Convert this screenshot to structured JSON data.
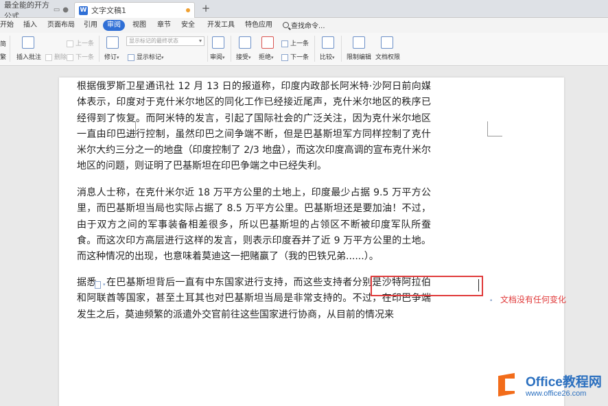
{
  "tabs": [
    {
      "label": "最全能的开方公式",
      "active": false
    },
    {
      "label": "文字文稿1",
      "active": true,
      "modified": true
    }
  ],
  "menu": {
    "items": [
      "开始",
      "插入",
      "页面布局",
      "引用",
      "审阅",
      "视图",
      "章节",
      "安全",
      "开发工具",
      "特色应用"
    ],
    "active": "审阅",
    "search_label": "查找命令..."
  },
  "toolbar": {
    "left_partial_1": "简",
    "left_partial_2": "繁",
    "insert_comment": "插入批注",
    "delete": "删除",
    "prev_comment": "上一条",
    "next_comment": "下一条",
    "track_changes": "修订",
    "display_combo": "显示标记的最终状态",
    "show_markup": "显示标记",
    "review": "审阅",
    "accept": "接受",
    "reject": "拒绝",
    "prev_change": "上一条",
    "next_change": "下一条",
    "compare": "比较",
    "restrict_edit": "限制编辑",
    "doc_permission": "文档权限"
  },
  "document": {
    "paragraphs": [
      "根据俄罗斯卫星通讯社 12 月 13 日的报道称，印度内政部长阿米特·沙阿日前向媒体表示，印度对于克什米尔地区的同化工作已经接近尾声，克什米尔地区的秩序已经得到了恢复。而阿米特的发言，引起了国际社会的广泛关注，因为克什米尔地区一直由印巴进行控制，虽然印巴之间争端不断，但是巴基斯坦军方同样控制了克什米尔大约三分之一的地盘（印度控制了 2/3 地盘），而这次印度高调的宣布克什米尔地区的问题，则证明了巴基斯坦在印巴争端之中已经失利。",
      "消息人士称，在克什米尔近 18 万平方公里的土地上，印度最少占据 9.5 万平方公里，而巴基斯坦当局也实际占据了 8.5 万平方公里。巴基斯坦还是要加油！不过，由于双方之间的军事装备相差很多，所以巴基斯坦的占领区不断被印度军队所蚕食。而这次印方高层进行这样的发言，则表示印度吞并了近 9 万平方公里的土地。而这种情况的出现，也意味着莫迪这一把赌赢了（我的巴铁兄弟......）。",
      "据悉，在巴基斯坦背后一直有中东国家进行支持，而这些支持者分别是沙特阿拉伯和阿联酋等国家，甚至土耳其也对巴基斯坦当局是非常支持的。不过，在印巴争端发生之后，莫迪频繁的派遣外交官前往这些国家进行协商，从目前的情况来"
    ],
    "annotation": "文档没有任何变化"
  },
  "watermark": {
    "title": "Office教程网",
    "url": "www.office26.com"
  },
  "colors": {
    "accent": "#2f6fd6",
    "annotation_red": "#e03a3a",
    "watermark_blue": "#2a6fbf",
    "watermark_orange": "#f26c1a"
  }
}
